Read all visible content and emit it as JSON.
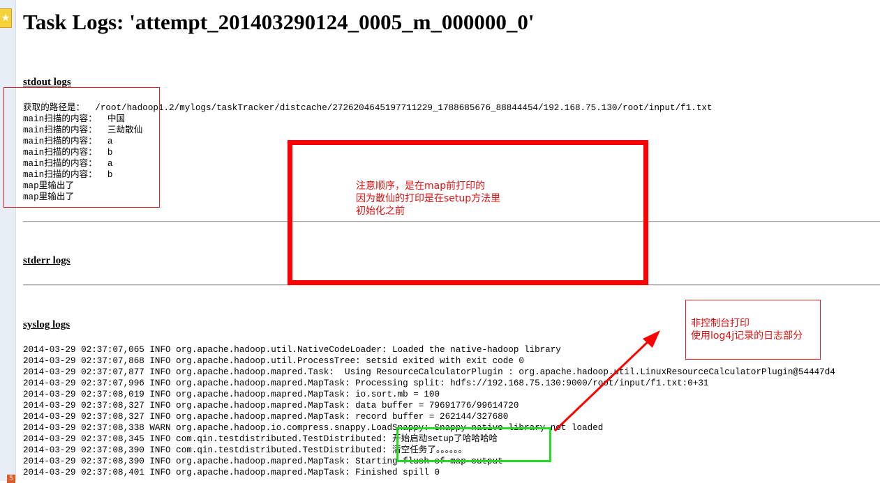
{
  "page_title": "Task Logs: 'attempt_201403290124_0005_m_000000_0'",
  "sections": {
    "stdout_label": "stdout logs",
    "stderr_label": "stderr logs",
    "syslog_label": "syslog logs"
  },
  "stdout_lines": [
    "获取的路径是：  /root/hadoop1.2/mylogs/taskTracker/distcache/2726204645197711229_1788685676_88844454/192.168.75.130/root/input/f1.txt",
    "main扫描的内容：  中国",
    "main扫描的内容：  三劫散仙",
    "main扫描的内容：  a",
    "main扫描的内容：  b",
    "main扫描的内容：  a",
    "main扫描的内容：  b",
    "map里输出了",
    "map里输出了"
  ],
  "syslog_lines": [
    "2014-03-29 02:37:07,065 INFO org.apache.hadoop.util.NativeCodeLoader: Loaded the native-hadoop library",
    "2014-03-29 02:37:07,868 INFO org.apache.hadoop.util.ProcessTree: setsid exited with exit code 0",
    "2014-03-29 02:37:07,877 INFO org.apache.hadoop.mapred.Task:  Using ResourceCalculatorPlugin : org.apache.hadoop.util.LinuxResourceCalculatorPlugin@54447d4",
    "2014-03-29 02:37:07,996 INFO org.apache.hadoop.mapred.MapTask: Processing split: hdfs://192.168.75.130:9000/root/input/f1.txt:0+31",
    "2014-03-29 02:37:08,019 INFO org.apache.hadoop.mapred.MapTask: io.sort.mb = 100",
    "2014-03-29 02:37:08,327 INFO org.apache.hadoop.mapred.MapTask: data buffer = 79691776/99614720",
    "2014-03-29 02:37:08,327 INFO org.apache.hadoop.mapred.MapTask: record buffer = 262144/327680",
    "2014-03-29 02:37:08,338 WARN org.apache.hadoop.io.compress.snappy.LoadSnappy: Snappy native library not loaded",
    "2014-03-29 02:37:08,345 INFO com.qin.testdistributed.TestDistributed: 开始启动setup了哈哈哈哈",
    "2014-03-29 02:37:08,390 INFO com.qin.testdistributed.TestDistributed: 清空任务了。。。。。。",
    "2014-03-29 02:37:08,390 INFO org.apache.hadoop.mapred.MapTask: Starting flush of map output",
    "2014-03-29 02:37:08,401 INFO org.apache.hadoop.mapred.MapTask: Finished spill 0"
  ],
  "annotations": {
    "order_note": [
      "注意顺序，是在map前打印的",
      "因为散仙的打印是在setup方法里",
      "初始化之前"
    ],
    "console_note": [
      "非控制台打印",
      "使用log4j记录的日志部分"
    ]
  },
  "browser": {
    "tab_badge": "5"
  },
  "colors": {
    "annotation_red": "#ff0000",
    "annotation_green": "#22dd22",
    "sidebar": "#e8eef6"
  },
  "icons": {
    "favorite": "star-icon"
  }
}
